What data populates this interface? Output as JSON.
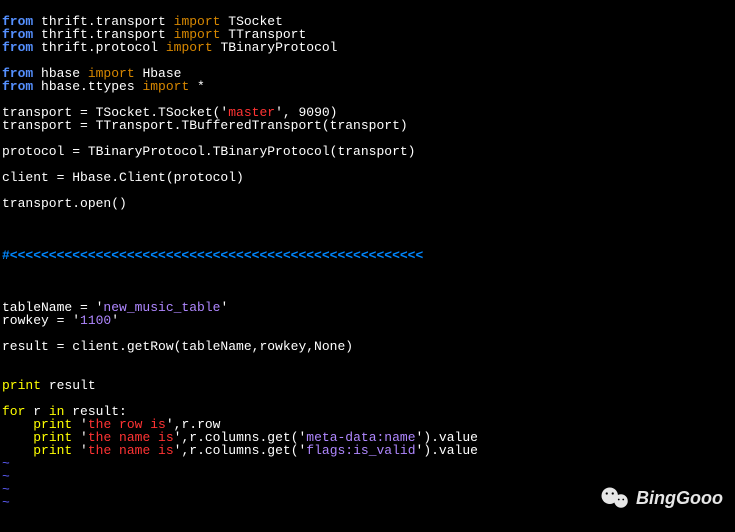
{
  "code": {
    "l1": {
      "kw1": "from",
      "t1": " thrift.transport ",
      "kw2": "import",
      "t2": " TSocket"
    },
    "l2": {
      "kw1": "from",
      "t1": " thrift.transport ",
      "kw2": "import",
      "t2": " TTransport"
    },
    "l3": {
      "kw1": "from",
      "t1": " thrift.protocol ",
      "kw2": "import",
      "t2": " TBinaryProtocol"
    },
    "l5": {
      "kw1": "from",
      "t1": " hbase ",
      "kw2": "import",
      "t2": " Hbase"
    },
    "l6": {
      "kw1": "from",
      "t1": " hbase.ttypes ",
      "kw2": "import",
      "t2": " *"
    },
    "l8": {
      "t1": "transport = TSocket.TSocket('",
      "s1": "master",
      "t2": "', 9090)"
    },
    "l9": "transport = TTransport.TBufferedTransport(transport)",
    "l11": "protocol = TBinaryProtocol.TBinaryProtocol(transport)",
    "l13": "client = Hbase.Client(protocol)",
    "l15": "transport.open()",
    "l19": "#<<<<<<<<<<<<<<<<<<<<<<<<<<<<<<<<<<<<<<<<<<<<<<<<<<<<<",
    "l23": {
      "t1": "tableName = '",
      "s1": "new_music_table",
      "t2": "'"
    },
    "l24": {
      "t1": "rowkey = '",
      "s1": "1100",
      "t2": "'"
    },
    "l26": "result = client.getRow(tableName,rowkey,None)",
    "l28": {
      "kw1": "print",
      "t1": " result"
    },
    "l30": {
      "kw1": "for",
      "t1": " r ",
      "kw2": "in",
      "t2": " result:"
    },
    "l31": {
      "t1": "    ",
      "kw1": "print",
      "t2": " '",
      "s1": "the row is",
      "t3": "',r.row"
    },
    "l32": {
      "t1": "    ",
      "kw1": "print",
      "t2": " '",
      "s1": "the name is",
      "t3": "',r.columns.get('",
      "s2": "meta-data:name",
      "t4": "').value"
    },
    "l33": {
      "t1": "    ",
      "kw1": "print",
      "t2": " '",
      "s1": "the name is",
      "t3": "',r.columns.get('",
      "s2": "flags:is_valid",
      "t4": "').value"
    },
    "tilde": "~"
  },
  "watermark": "BingGooo"
}
